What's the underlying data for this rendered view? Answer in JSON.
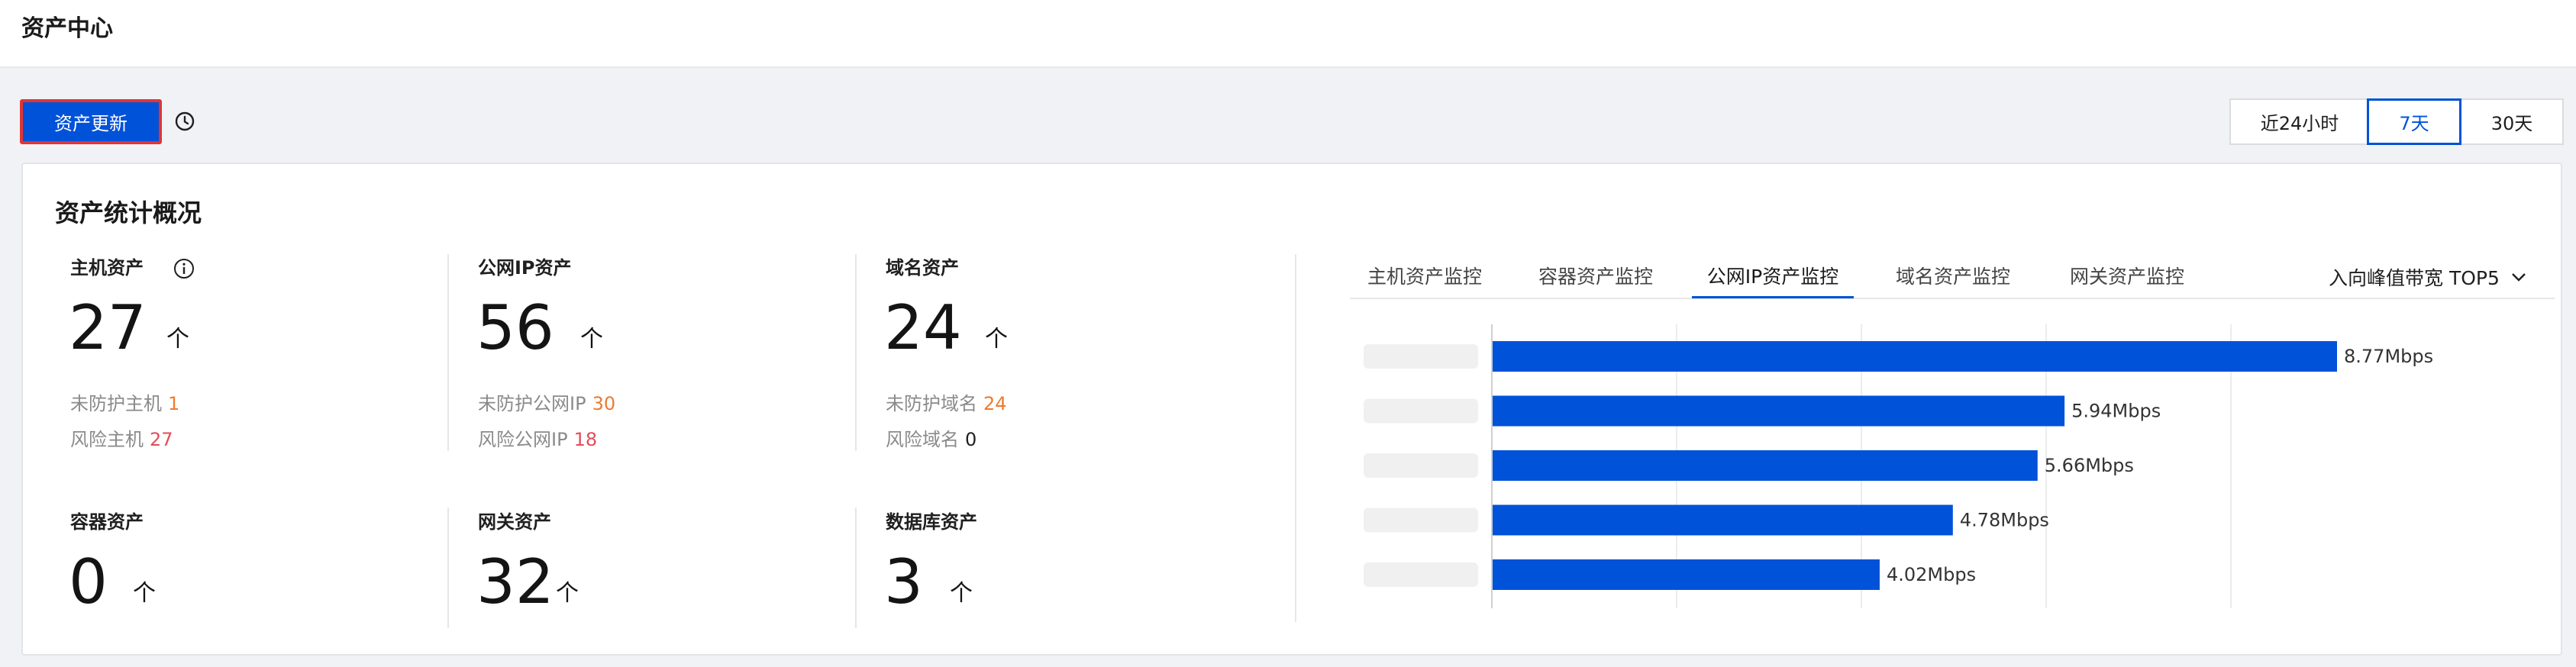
{
  "header": {
    "title": "资产中心"
  },
  "toolbar": {
    "update_label": "资产更新",
    "history_icon": "clock-icon",
    "ranges": [
      {
        "label": "近24小时",
        "active": false
      },
      {
        "label": "7天",
        "active": true
      },
      {
        "label": "30天",
        "active": false
      }
    ]
  },
  "overview": {
    "title": "资产统计概况",
    "unit": "个",
    "host": {
      "label": "主机资产",
      "value": "27",
      "sub1_label": "未防护主机",
      "sub1_value": "1",
      "sub2_label": "风险主机",
      "sub2_value": "27"
    },
    "ip": {
      "label": "公网IP资产",
      "value": "56",
      "sub1_label": "未防护公网IP",
      "sub1_value": "30",
      "sub2_label": "风险公网IP",
      "sub2_value": "18"
    },
    "domain": {
      "label": "域名资产",
      "value": "24",
      "sub1_label": "未防护域名",
      "sub1_value": "24",
      "sub2_label": "风险域名",
      "sub2_value": "0"
    },
    "container": {
      "label": "容器资产",
      "value": "0"
    },
    "gateway": {
      "label": "网关资产",
      "value": "32"
    },
    "database": {
      "label": "数据库资产",
      "value": "3"
    }
  },
  "monitor": {
    "tabs": [
      "主机资产监控",
      "容器资产监控",
      "公网IP资产监控",
      "域名资产监控",
      "网关资产监控"
    ],
    "active_tab": 2,
    "dropdown_label": "入向峰值带宽 TOP5",
    "accent": "#0052d9"
  },
  "chart_data": {
    "type": "bar",
    "orientation": "horizontal",
    "values": [
      8.77,
      5.94,
      5.66,
      4.78,
      4.02
    ],
    "data_labels": [
      "8.77Mbps",
      "5.94Mbps",
      "5.66Mbps",
      "4.78Mbps",
      "4.02Mbps"
    ],
    "unit": "Mbps",
    "xlim": [
      0,
      8.77
    ],
    "grid": true,
    "color": "#0052d9"
  }
}
